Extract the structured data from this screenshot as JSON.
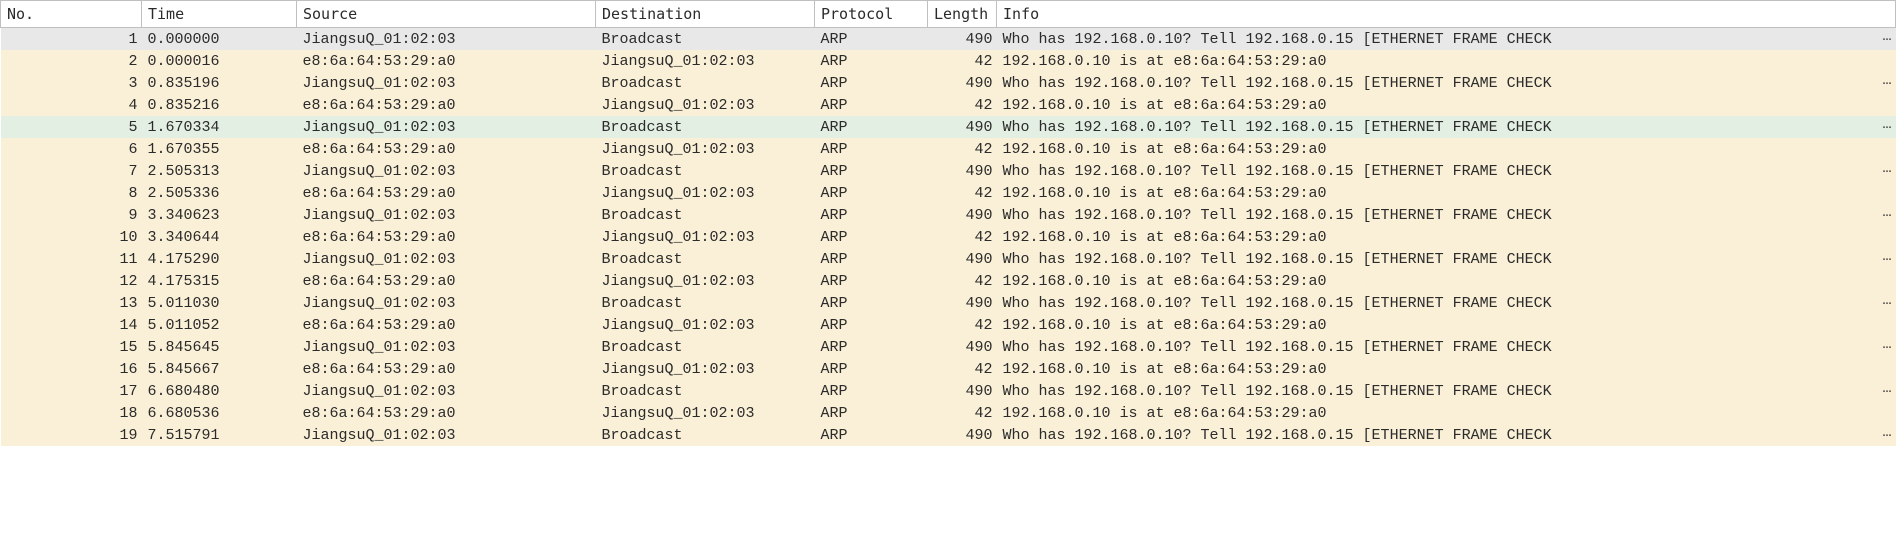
{
  "columns": {
    "no": "No.",
    "time": "Time",
    "source": "Source",
    "destination": "Destination",
    "protocol": "Protocol",
    "length": "Length",
    "info": "Info"
  },
  "info_ellipsis": "…",
  "rows": [
    {
      "no": 1,
      "time": "0.000000",
      "source": "JiangsuQ_01:02:03",
      "destination": "Broadcast",
      "protocol": "ARP",
      "length": 490,
      "info": "Who has 192.168.0.10? Tell 192.168.0.15 [ETHERNET FRAME CHECK ",
      "truncated": true,
      "state": "selected"
    },
    {
      "no": 2,
      "time": "0.000016",
      "source": "e8:6a:64:53:29:a0",
      "destination": "JiangsuQ_01:02:03",
      "protocol": "ARP",
      "length": 42,
      "info": "192.168.0.10 is at e8:6a:64:53:29:a0",
      "truncated": false,
      "state": ""
    },
    {
      "no": 3,
      "time": "0.835196",
      "source": "JiangsuQ_01:02:03",
      "destination": "Broadcast",
      "protocol": "ARP",
      "length": 490,
      "info": "Who has 192.168.0.10? Tell 192.168.0.15 [ETHERNET FRAME CHECK ",
      "truncated": true,
      "state": ""
    },
    {
      "no": 4,
      "time": "0.835216",
      "source": "e8:6a:64:53:29:a0",
      "destination": "JiangsuQ_01:02:03",
      "protocol": "ARP",
      "length": 42,
      "info": "192.168.0.10 is at e8:6a:64:53:29:a0",
      "truncated": false,
      "state": ""
    },
    {
      "no": 5,
      "time": "1.670334",
      "source": "JiangsuQ_01:02:03",
      "destination": "Broadcast",
      "protocol": "ARP",
      "length": 490,
      "info": "Who has 192.168.0.10? Tell 192.168.0.15 [ETHERNET FRAME CHECK ",
      "truncated": true,
      "state": "highlighted"
    },
    {
      "no": 6,
      "time": "1.670355",
      "source": "e8:6a:64:53:29:a0",
      "destination": "JiangsuQ_01:02:03",
      "protocol": "ARP",
      "length": 42,
      "info": "192.168.0.10 is at e8:6a:64:53:29:a0",
      "truncated": false,
      "state": ""
    },
    {
      "no": 7,
      "time": "2.505313",
      "source": "JiangsuQ_01:02:03",
      "destination": "Broadcast",
      "protocol": "ARP",
      "length": 490,
      "info": "Who has 192.168.0.10? Tell 192.168.0.15 [ETHERNET FRAME CHECK ",
      "truncated": true,
      "state": ""
    },
    {
      "no": 8,
      "time": "2.505336",
      "source": "e8:6a:64:53:29:a0",
      "destination": "JiangsuQ_01:02:03",
      "protocol": "ARP",
      "length": 42,
      "info": "192.168.0.10 is at e8:6a:64:53:29:a0",
      "truncated": false,
      "state": ""
    },
    {
      "no": 9,
      "time": "3.340623",
      "source": "JiangsuQ_01:02:03",
      "destination": "Broadcast",
      "protocol": "ARP",
      "length": 490,
      "info": "Who has 192.168.0.10? Tell 192.168.0.15 [ETHERNET FRAME CHECK ",
      "truncated": true,
      "state": ""
    },
    {
      "no": 10,
      "time": "3.340644",
      "source": "e8:6a:64:53:29:a0",
      "destination": "JiangsuQ_01:02:03",
      "protocol": "ARP",
      "length": 42,
      "info": "192.168.0.10 is at e8:6a:64:53:29:a0",
      "truncated": false,
      "state": ""
    },
    {
      "no": 11,
      "time": "4.175290",
      "source": "JiangsuQ_01:02:03",
      "destination": "Broadcast",
      "protocol": "ARP",
      "length": 490,
      "info": "Who has 192.168.0.10? Tell 192.168.0.15 [ETHERNET FRAME CHECK ",
      "truncated": true,
      "state": ""
    },
    {
      "no": 12,
      "time": "4.175315",
      "source": "e8:6a:64:53:29:a0",
      "destination": "JiangsuQ_01:02:03",
      "protocol": "ARP",
      "length": 42,
      "info": "192.168.0.10 is at e8:6a:64:53:29:a0",
      "truncated": false,
      "state": ""
    },
    {
      "no": 13,
      "time": "5.011030",
      "source": "JiangsuQ_01:02:03",
      "destination": "Broadcast",
      "protocol": "ARP",
      "length": 490,
      "info": "Who has 192.168.0.10? Tell 192.168.0.15 [ETHERNET FRAME CHECK ",
      "truncated": true,
      "state": ""
    },
    {
      "no": 14,
      "time": "5.011052",
      "source": "e8:6a:64:53:29:a0",
      "destination": "JiangsuQ_01:02:03",
      "protocol": "ARP",
      "length": 42,
      "info": "192.168.0.10 is at e8:6a:64:53:29:a0",
      "truncated": false,
      "state": ""
    },
    {
      "no": 15,
      "time": "5.845645",
      "source": "JiangsuQ_01:02:03",
      "destination": "Broadcast",
      "protocol": "ARP",
      "length": 490,
      "info": "Who has 192.168.0.10? Tell 192.168.0.15 [ETHERNET FRAME CHECK ",
      "truncated": true,
      "state": ""
    },
    {
      "no": 16,
      "time": "5.845667",
      "source": "e8:6a:64:53:29:a0",
      "destination": "JiangsuQ_01:02:03",
      "protocol": "ARP",
      "length": 42,
      "info": "192.168.0.10 is at e8:6a:64:53:29:a0",
      "truncated": false,
      "state": ""
    },
    {
      "no": 17,
      "time": "6.680480",
      "source": "JiangsuQ_01:02:03",
      "destination": "Broadcast",
      "protocol": "ARP",
      "length": 490,
      "info": "Who has 192.168.0.10? Tell 192.168.0.15 [ETHERNET FRAME CHECK ",
      "truncated": true,
      "state": ""
    },
    {
      "no": 18,
      "time": "6.680536",
      "source": "e8:6a:64:53:29:a0",
      "destination": "JiangsuQ_01:02:03",
      "protocol": "ARP",
      "length": 42,
      "info": "192.168.0.10 is at e8:6a:64:53:29:a0",
      "truncated": false,
      "state": ""
    },
    {
      "no": 19,
      "time": "7.515791",
      "source": "JiangsuQ_01:02:03",
      "destination": "Broadcast",
      "protocol": "ARP",
      "length": 490,
      "info": "Who has 192.168.0.10? Tell 192.168.0.15 [ETHERNET FRAME CHECK ",
      "truncated": true,
      "state": ""
    }
  ]
}
